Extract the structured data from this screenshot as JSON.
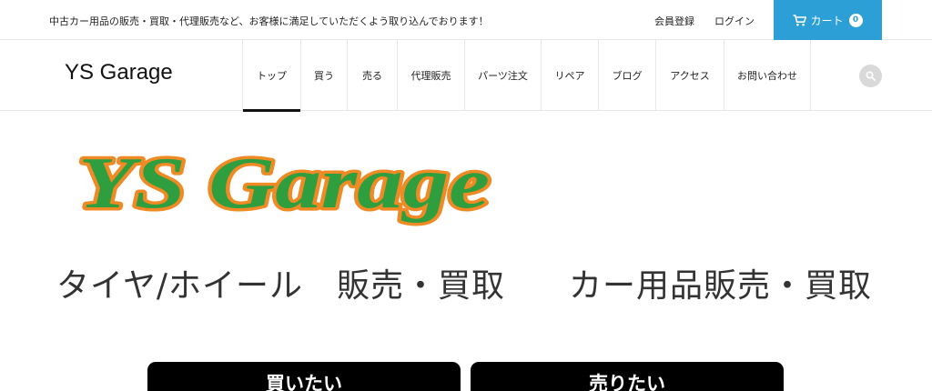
{
  "topbar": {
    "tagline": "中古カー用品の販売・買取・代理販売など、お客様に満足していただくよう取り込んでおります！",
    "register_label": "会員登録",
    "login_label": "ログイン",
    "cart": {
      "label": "カート",
      "count": "0",
      "icon": "cart-icon",
      "color": "#2b9fd6"
    }
  },
  "header": {
    "site_title": "YS Garage",
    "nav": [
      {
        "label": "トップ",
        "active": true
      },
      {
        "label": "買う"
      },
      {
        "label": "売る"
      },
      {
        "label": "代理販売"
      },
      {
        "label": "パーツ注文"
      },
      {
        "label": "リペア"
      },
      {
        "label": "ブログ"
      },
      {
        "label": "アクセス"
      },
      {
        "label": "お問い合わせ"
      }
    ],
    "search_icon": "search-icon"
  },
  "hero": {
    "logo_text": "YS Garage",
    "logo_colors": {
      "fill": "#2e9e3e",
      "outline": "#f08a24"
    },
    "service_left": "タイヤ/ホイール　販売・買取",
    "service_right": "カー用品販売・買取"
  },
  "cta": {
    "buy_label": "買いたい",
    "sell_label": "売りたい"
  }
}
